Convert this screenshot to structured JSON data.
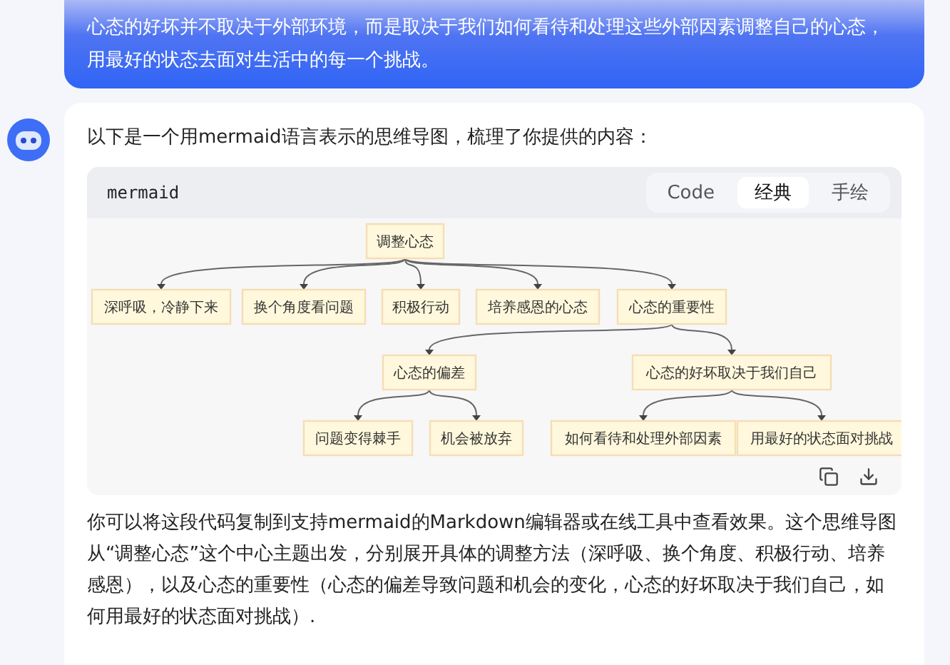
{
  "user_message": {
    "text": "心态的好坏并不取决于外部环境，而是取决于我们如何看待和处理这些外部因素调整自己的心态，用最好的状态去面对生活中的每一个挑战。"
  },
  "answer": {
    "intro": "以下是一个用mermaid语言表示的思维导图，梳理了你提供的内容：",
    "code_block": {
      "language": "mermaid",
      "tabs": [
        {
          "label": "Code",
          "selected": false
        },
        {
          "label": "经典",
          "selected": true
        },
        {
          "label": "手绘",
          "selected": false
        }
      ],
      "mindmap": {
        "label": "调整心态",
        "children": [
          {
            "label": "深呼吸，冷静下来"
          },
          {
            "label": "换个角度看问题"
          },
          {
            "label": "积极行动"
          },
          {
            "label": "培养感恩的心态"
          },
          {
            "label": "心态的重要性",
            "children": [
              {
                "label": "心态的偏差",
                "children": [
                  {
                    "label": "问题变得棘手"
                  },
                  {
                    "label": "机会被放弃"
                  }
                ]
              },
              {
                "label": "心态的好坏取决于我们自己",
                "children": [
                  {
                    "label": "如何看待和处理外部因素"
                  },
                  {
                    "label": "用最好的状态面对挑战"
                  }
                ]
              }
            ]
          }
        ]
      }
    },
    "summary": "你可以将这段代码复制到支持mermaid的Markdown编辑器或在线工具中查看效果。这个思维导图从“调整心态”这个中心主题出发，分别展开具体的调整方法（深呼吸、换个角度、积极行动、培养感恩），以及心态的重要性（心态的偏差导致问题和机会的变化，心态的好坏取决于我们自己，如何用最好的状态面对挑战）."
  }
}
